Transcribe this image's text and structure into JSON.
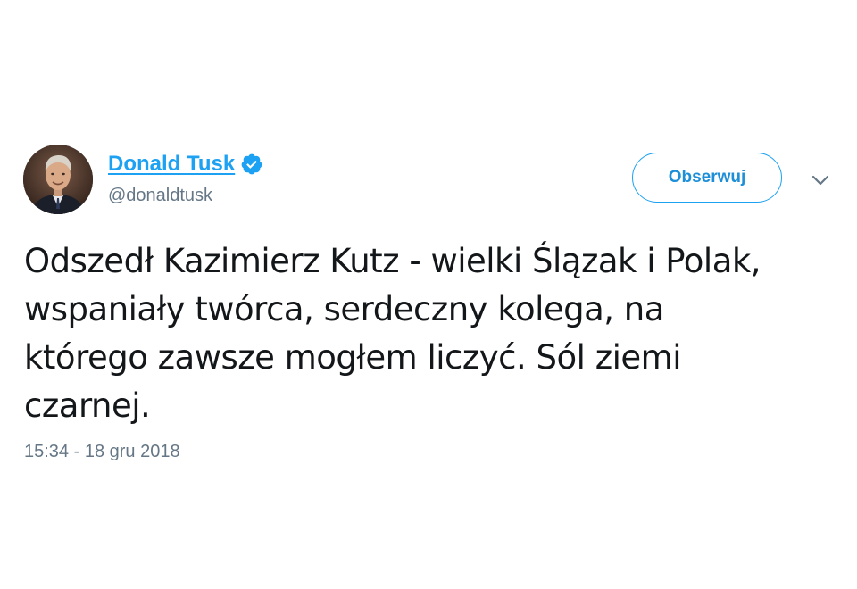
{
  "author": {
    "display_name": "Donald Tusk",
    "handle": "@donaldtusk",
    "verified": true
  },
  "actions": {
    "follow_label": "Obserwuj"
  },
  "tweet": {
    "text": "Odszedł Kazimierz Kutz - wielki Ślązak i Polak,\nwspaniały twórca, serdeczny kolega, na\nktórego zawsze mogłem liczyć. Sól ziemi\nczarnej.",
    "timestamp": "15:34 - 18 gru 2018"
  },
  "colors": {
    "accent": "#1da1f2",
    "text": "#14171a",
    "muted": "#657786"
  },
  "icons": {
    "verified": "verified-badge-icon",
    "menu": "chevron-down-icon"
  }
}
